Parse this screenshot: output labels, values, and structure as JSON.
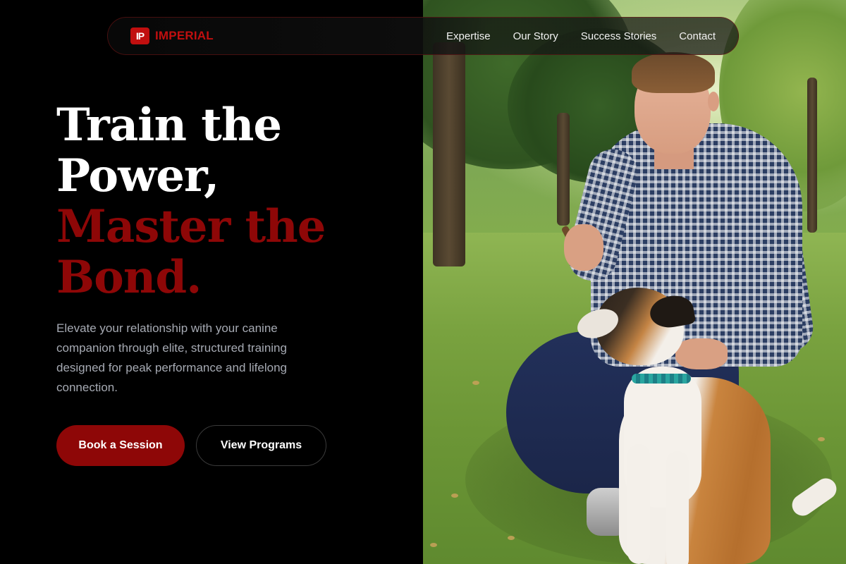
{
  "brand": {
    "mark": "IP",
    "name": "IMPERIAL"
  },
  "nav": {
    "links": [
      "Expertise",
      "Our Story",
      "Success Stories",
      "Contact"
    ]
  },
  "hero": {
    "title_white": [
      "Train the",
      "Power,"
    ],
    "title_red": [
      "Master the",
      "Bond."
    ],
    "description": "Elevate your relationship with your canine companion through elite, structured training designed for peak performance and lifelong connection.",
    "primary_button": "Book a Session",
    "secondary_button": "View Programs"
  },
  "colors": {
    "accent": "#8e0707",
    "brand_red": "#c10f0f",
    "background": "#000000",
    "body_text": "#a6aab3"
  }
}
